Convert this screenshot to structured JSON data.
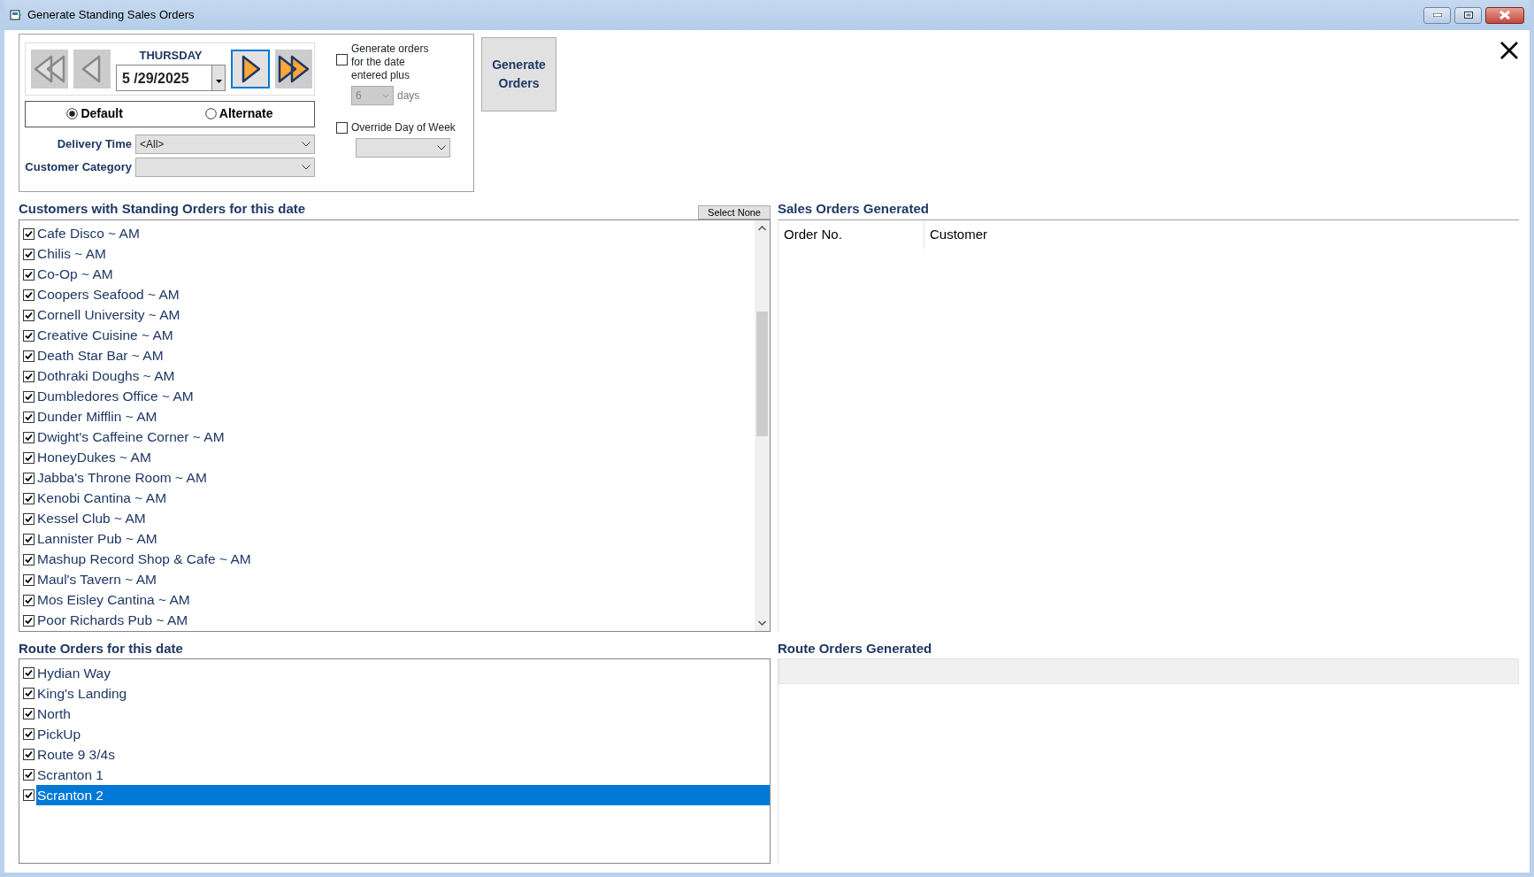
{
  "window": {
    "title": "Generate Standing Sales Orders"
  },
  "date_nav": {
    "day": "THURSDAY",
    "date": "5 /29/2025"
  },
  "modes": [
    {
      "label": "Default",
      "selected": true
    },
    {
      "label": "Alternate",
      "selected": false
    }
  ],
  "filters": [
    {
      "label": "Delivery Time",
      "value": "<All>"
    },
    {
      "label": "Customer Category"
    }
  ],
  "generate_plus": {
    "label": "Generate orders for the date entered plus",
    "checked": false,
    "days_value": "6",
    "days_label": "days",
    "disabled": true
  },
  "override_day": {
    "label": "Override Day of Week",
    "checked": false
  },
  "generate_button": "Generate Orders",
  "customers": {
    "title": "Customers with Standing Orders for this date",
    "select_none_button": "Select None",
    "items": [
      {
        "label": "Cafe Disco ~ AM",
        "checked": true,
        "selected": false
      },
      {
        "label": "Chilis ~ AM",
        "checked": true,
        "selected": false
      },
      {
        "label": "Co-Op ~ AM",
        "checked": true,
        "selected": false
      },
      {
        "label": "Coopers Seafood ~ AM",
        "checked": true,
        "selected": false
      },
      {
        "label": "Cornell University ~ AM",
        "checked": true,
        "selected": false
      },
      {
        "label": "Creative Cuisine ~ AM",
        "checked": true,
        "selected": false
      },
      {
        "label": "Death Star Bar ~ AM",
        "checked": true,
        "selected": false
      },
      {
        "label": "Dothraki Doughs ~ AM",
        "checked": true,
        "selected": false
      },
      {
        "label": "Dumbledores Office ~ AM",
        "checked": true,
        "selected": false
      },
      {
        "label": "Dunder Mifflin ~ AM",
        "checked": true,
        "selected": false
      },
      {
        "label": "Dwight's Caffeine Corner ~ AM",
        "checked": true,
        "selected": false
      },
      {
        "label": "HoneyDukes ~ AM",
        "checked": true,
        "selected": false
      },
      {
        "label": "Jabba's Throne Room ~ AM",
        "checked": true,
        "selected": false
      },
      {
        "label": "Kenobi Cantina ~ AM",
        "checked": true,
        "selected": false
      },
      {
        "label": "Kessel Club ~ AM",
        "checked": true,
        "selected": false
      },
      {
        "label": "Lannister Pub ~ AM",
        "checked": true,
        "selected": false
      },
      {
        "label": "Mashup Record Shop & Cafe ~ AM",
        "checked": true,
        "selected": false
      },
      {
        "label": "Maul's Tavern ~ AM",
        "checked": true,
        "selected": false
      },
      {
        "label": "Mos Eisley Cantina ~ AM",
        "checked": true,
        "selected": false
      },
      {
        "label": "Poor Richards Pub ~ AM",
        "checked": true,
        "selected": false
      }
    ]
  },
  "sales_orders": {
    "title": "Sales Orders Generated",
    "columns": [
      "Order No.",
      "Customer"
    ]
  },
  "routes": {
    "title": "Route Orders for this date",
    "items": [
      {
        "label": "Hydian Way",
        "checked": true,
        "selected": false
      },
      {
        "label": "King's Landing",
        "checked": true,
        "selected": false
      },
      {
        "label": "North",
        "checked": true,
        "selected": false
      },
      {
        "label": "PickUp",
        "checked": true,
        "selected": false
      },
      {
        "label": "Route 9 3/4s",
        "checked": true,
        "selected": false
      },
      {
        "label": "Scranton 1",
        "checked": true,
        "selected": false
      },
      {
        "label": "Scranton 2",
        "checked": true,
        "selected": true
      }
    ]
  },
  "route_generated": {
    "title": "Route Orders Generated"
  }
}
